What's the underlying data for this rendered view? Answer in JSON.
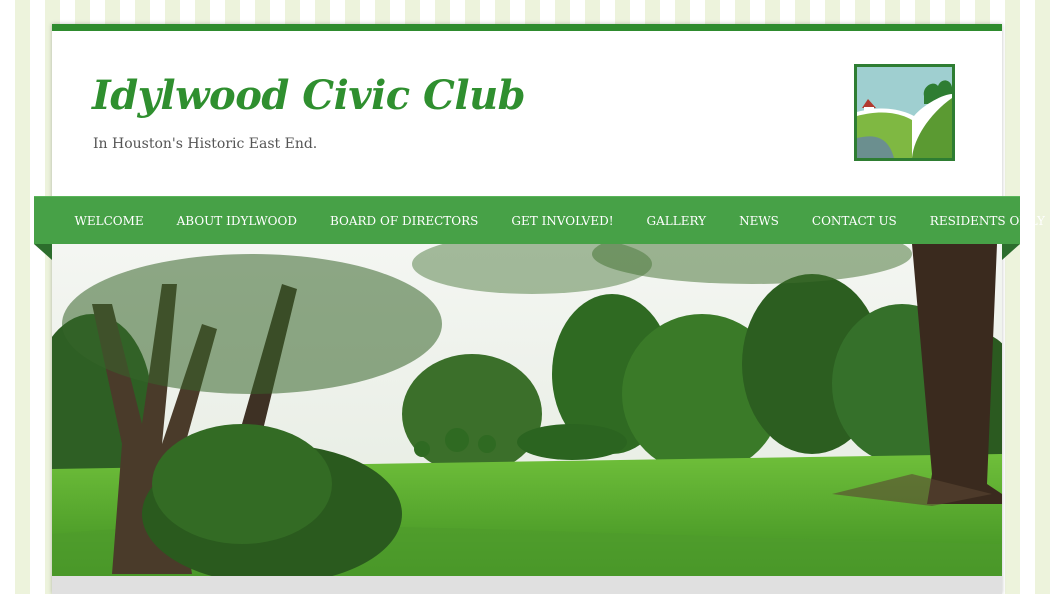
{
  "header": {
    "site_title": "Idylwood Civic Club",
    "tagline": "In Houston's Historic East End."
  },
  "nav": {
    "items": [
      {
        "label": "WELCOME"
      },
      {
        "label": "ABOUT IDYLWOOD"
      },
      {
        "label": "BOARD OF DIRECTORS"
      },
      {
        "label": "GET INVOLVED!"
      },
      {
        "label": "GALLERY"
      },
      {
        "label": "NEWS"
      },
      {
        "label": "CONTACT US"
      },
      {
        "label": "RESIDENTS ONLY"
      }
    ]
  },
  "colors": {
    "brand_green": "#2f8f2f",
    "nav_green": "#47a147",
    "stripe_green": "#edf3dc"
  },
  "icons": {
    "logo": "landscape-logo-icon"
  }
}
